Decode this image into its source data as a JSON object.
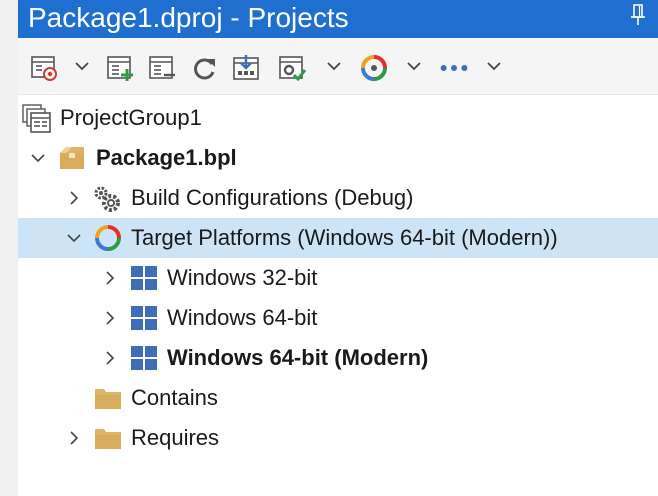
{
  "window": {
    "title": "Package1.dproj - Projects"
  },
  "toolbar": {
    "items": [
      {
        "icon": "project-options-icon",
        "has_dropdown": true
      },
      {
        "icon": "add-new-project-icon",
        "has_dropdown": false
      },
      {
        "icon": "add-existing-project-icon",
        "has_dropdown": false
      },
      {
        "icon": "refresh-icon",
        "has_dropdown": false
      },
      {
        "icon": "build-all-icon",
        "has_dropdown": false
      },
      {
        "icon": "build-configuration-icon",
        "has_dropdown": true
      },
      {
        "icon": "target-platform-icon",
        "has_dropdown": true
      },
      {
        "icon": "more-options-icon",
        "has_dropdown": true
      }
    ]
  },
  "tree": {
    "items": [
      {
        "label": "ProjectGroup1",
        "icon": "project-group-icon",
        "expander": "none",
        "bold": false
      },
      {
        "label": "Package1.bpl",
        "icon": "package-icon",
        "expander": "expanded",
        "bold": true
      },
      {
        "label": "Build Configurations (Debug)",
        "icon": "gears-icon",
        "expander": "collapsed",
        "bold": false
      },
      {
        "label": "Target Platforms (Windows 64-bit (Modern))",
        "icon": "target-platform-icon",
        "expander": "expanded",
        "bold": false,
        "selected": true
      },
      {
        "label": "Windows 32-bit",
        "icon": "windows-icon",
        "expander": "collapsed",
        "bold": false
      },
      {
        "label": "Windows 64-bit",
        "icon": "windows-icon",
        "expander": "collapsed",
        "bold": false
      },
      {
        "label": "Windows 64-bit (Modern)",
        "icon": "windows-icon",
        "expander": "collapsed",
        "bold": true
      },
      {
        "label": "Contains",
        "icon": "folder-icon",
        "expander": "none",
        "bold": false
      },
      {
        "label": "Requires",
        "icon": "folder-icon",
        "expander": "collapsed",
        "bold": false
      }
    ]
  },
  "colors": {
    "titlebar": "#1f6fd1",
    "selection": "#cde4f7",
    "windows_blue": "#3f6db8",
    "folder": "#dcb46a"
  }
}
